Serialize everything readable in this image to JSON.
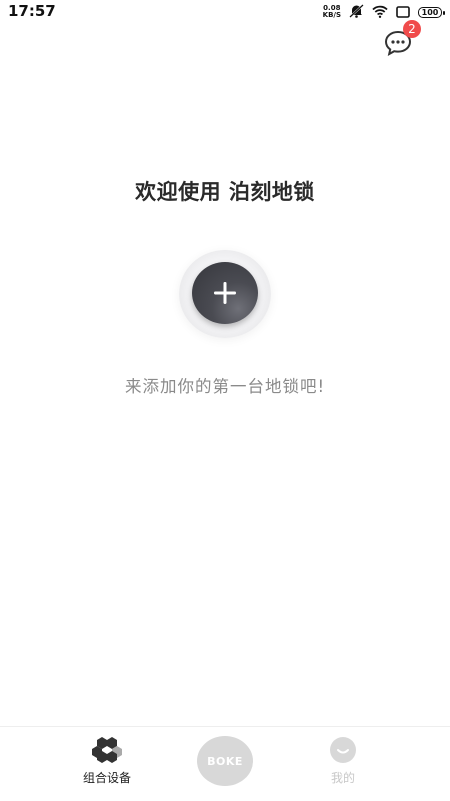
{
  "status_bar": {
    "time": "17:57",
    "net_speed_value": "0.08",
    "net_speed_unit": "KB/S",
    "battery": "100",
    "icons": [
      "mute-icon",
      "wifi-icon",
      "screen-icon",
      "battery-icon"
    ]
  },
  "header": {
    "message_icon": "chat-bubble-icon",
    "message_badge": "2"
  },
  "main": {
    "title": "欢迎使用 泊刻地锁",
    "add_icon": "plus-icon",
    "hint": "来添加你的第一台地锁吧!"
  },
  "bottom_nav": {
    "items": [
      {
        "label": "组合设备",
        "icon": "hexagon-cluster-icon",
        "active": true
      },
      {
        "label": "BOKE",
        "icon": "brand-logo",
        "active": false
      },
      {
        "label": "我的",
        "icon": "smile-face-icon",
        "active": false
      }
    ]
  },
  "colors": {
    "accent_dark": "#3a3b41",
    "badge_red": "#f04b4b",
    "inactive_gray": "#c8c8c8",
    "hint_gray": "#8a8a8a"
  }
}
